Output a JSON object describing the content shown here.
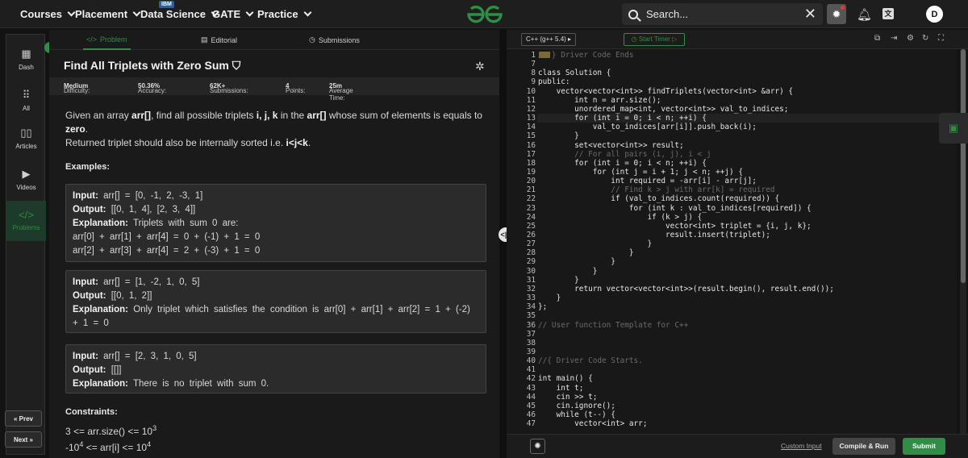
{
  "nav": {
    "items": [
      "Courses",
      "Placement",
      "Data Science",
      "GATE",
      "Practice"
    ],
    "ibm_badge": "IBM",
    "logo": "gfg-logo",
    "search_value": "Search...",
    "avatar_initial": "D"
  },
  "sidebar": {
    "items": [
      {
        "label": "Dash",
        "icon": "dashboard-icon"
      },
      {
        "label": "All",
        "icon": "grid-icon"
      },
      {
        "label": "Articles",
        "icon": "book-icon"
      },
      {
        "label": "Videos",
        "icon": "video-icon"
      },
      {
        "label": "Problems",
        "icon": "code-icon"
      }
    ],
    "prev": "« Prev",
    "next": "Next »"
  },
  "tabs": {
    "problem": "Problem",
    "editorial": "Editorial",
    "submissions": "Submissions"
  },
  "problem": {
    "title": "Find All Triplets with Zero Sum",
    "difficulty_label": "Difficulty:",
    "difficulty": "Medium",
    "accuracy_label": "Accuracy:",
    "accuracy": "50.36%",
    "submissions_label": "Submissions:",
    "submissions": "62K+",
    "points_label": "Points:",
    "points": "4",
    "avg_time_label": "Average Time:",
    "avg_time": "25m",
    "desc_1": "Given an array ",
    "desc_arr": "arr[]",
    "desc_2": ", find all possible triplets ",
    "desc_ijk": "i, j, k",
    "desc_3": " in the ",
    "desc_arr2": "arr[]",
    "desc_4": " whose sum of elements is equals to ",
    "desc_zero": "zero",
    "desc_5": ".",
    "desc_sorted": "Returned triplet should also be internally sorted i.e. ",
    "desc_order": "i<j<k",
    "desc_end": ".",
    "examples_heading": "Examples:",
    "input_label": "Input:",
    "output_label": "Output:",
    "explanation_label": "Explanation:",
    "examples": [
      {
        "input": "arr[] = [0, -1, 2, -3, 1]",
        "output": "[[0, 1, 4], [2, 3, 4]]",
        "explanation": "Triplets with sum 0 are:",
        "lines": [
          "arr[0] + arr[1] + arr[4] = 0 + (-1) + 1 = 0",
          "arr[2] + arr[3] + arr[4] = 2 + (-3) + 1 = 0"
        ]
      },
      {
        "input": "arr[] = [1, -2, 1, 0, 5]",
        "output": "[[0, 1, 2]]",
        "explanation": "Only triplet which satisfies the condition is arr[0] + arr[1] + arr[2] = 1 + (-2) + 1 = 0"
      },
      {
        "input": "arr[] = [2, 3, 1, 0, 5]",
        "output": "[[]]",
        "explanation": "There is no triplet with sum 0."
      }
    ],
    "constraints_heading": "Constraints:",
    "c1_a": "3 <= arr.size() <= 10",
    "c1_sup": "3",
    "c2_a": "-10",
    "c2_sup1": "4",
    "c2_b": " <= arr[i] <= 10",
    "c2_sup2": "4"
  },
  "editor": {
    "language": "C++ (g++ 5.4)",
    "timer": "Start Timer",
    "custom_input": "Custom Input",
    "compile_run": "Compile & Run",
    "submit": "Submit",
    "line_numbers": [
      "1",
      "7",
      "8",
      "9",
      "10",
      "11",
      "12",
      "13",
      "14",
      "15",
      "16",
      "17",
      "18",
      "19",
      "20",
      "21",
      "22",
      "23",
      "24",
      "25",
      "26",
      "27",
      "28",
      "29",
      "30",
      "31",
      "32",
      "33",
      "34",
      "35",
      "36",
      "37",
      "38",
      "39",
      "40",
      "41",
      "42",
      "43",
      "44",
      "45",
      "46",
      "47"
    ],
    "code_lines": [
      "// } Driver Code Ends",
      "",
      "class Solution {",
      "public:",
      "    vector<vector<int>> findTriplets(vector<int> &arr) {",
      "        int n = arr.size();",
      "        unordered_map<int, vector<int>> val_to_indices;",
      "        for (int i = 0; i < n; ++i) {",
      "            val_to_indices[arr[i]].push_back(i);",
      "        }",
      "        set<vector<int>> result;",
      "        // For all pairs (i, j), i < j",
      "        for (int i = 0; i < n; ++i) {",
      "            for (int j = i + 1; j < n; ++j) {",
      "                int required = -arr[i] - arr[j];",
      "                // Find k > j with arr[k] = required",
      "                if (val_to_indices.count(required)) {",
      "                    for (int k : val_to_indices[required]) {",
      "                        if (k > j) {",
      "                            vector<int> triplet = {i, j, k};",
      "                            result.insert(triplet);",
      "                        }",
      "                    }",
      "                }",
      "            }",
      "        }",
      "        return vector<vector<int>>(result.begin(), result.end());",
      "    }",
      "};",
      "",
      "// User function Template for C++",
      "",
      "",
      "",
      "//{ Driver Code Starts.",
      "",
      "int main() {",
      "    int t;",
      "    cin >> t;",
      "    cin.ignore();",
      "    while (t--) {",
      "        vector<int> arr;"
    ]
  }
}
